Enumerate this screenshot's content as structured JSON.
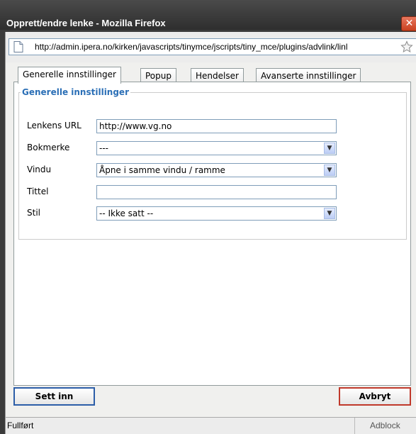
{
  "window": {
    "title": "Opprett/endre lenke - Mozilla Firefox",
    "close_glyph": "✕"
  },
  "browser": {
    "url": "http://admin.ipera.no/kirken/javascripts/tinymce/jscripts/tiny_mce/plugins/advlink/linl"
  },
  "tabs": [
    {
      "label": "Generelle innstillinger",
      "active": true
    },
    {
      "label": "Popup",
      "active": false
    },
    {
      "label": "Hendelser",
      "active": false
    },
    {
      "label": "Avanserte innstillinger",
      "active": false
    }
  ],
  "form": {
    "legend": "Generelle innstillinger",
    "url": {
      "label": "Lenkens URL",
      "value": "http://www.vg.no"
    },
    "bookmark": {
      "label": "Bokmerke",
      "value": "---"
    },
    "window": {
      "label": "Vindu",
      "value": "Åpne i samme vindu / ramme"
    },
    "title": {
      "label": "Tittel",
      "value": ""
    },
    "style": {
      "label": "Stil",
      "value": "-- Ikke satt --"
    }
  },
  "buttons": {
    "insert": "Sett inn",
    "cancel": "Avbryt"
  },
  "status": {
    "text": "Fullført",
    "addon": "Adblock"
  },
  "colors": {
    "legend": "#2b6fb6",
    "titlebar": "#3b3b3b",
    "insert_border": "#2c5ea8",
    "cancel_border": "#c0392b"
  }
}
